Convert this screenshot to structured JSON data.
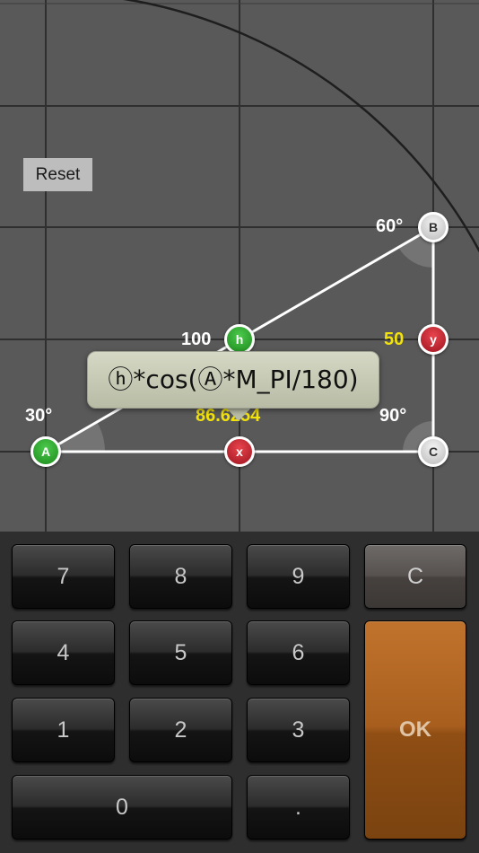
{
  "canvas": {
    "reset_label": "Reset",
    "background_color": "#595959",
    "grid_color": "#2a2a2a",
    "triangle_color": "#ffffff"
  },
  "vertices": {
    "A": {
      "label": "A",
      "angle": "30°",
      "color": "green"
    },
    "B": {
      "label": "B",
      "angle": "60°",
      "color": "gray"
    },
    "C": {
      "label": "C",
      "angle": "90°",
      "color": "gray"
    }
  },
  "sides": {
    "h": {
      "label": "h",
      "value": "100",
      "color": "green"
    },
    "x": {
      "label": "x",
      "value": "86.6254",
      "color": "red"
    },
    "y": {
      "label": "y",
      "value": "50",
      "color": "red"
    }
  },
  "formula": {
    "text": "ⓗ*cos(Ⓐ*M_PI/180)"
  },
  "keypad": {
    "keys": {
      "k7": "7",
      "k8": "8",
      "k9": "9",
      "k4": "4",
      "k5": "5",
      "k6": "6",
      "k1": "1",
      "k2": "2",
      "k3": "3",
      "k0": "0",
      "dot": ".",
      "clear": "C",
      "ok": "OK"
    },
    "ok_color": "#a85f1e",
    "clear_color": "#57524f"
  }
}
